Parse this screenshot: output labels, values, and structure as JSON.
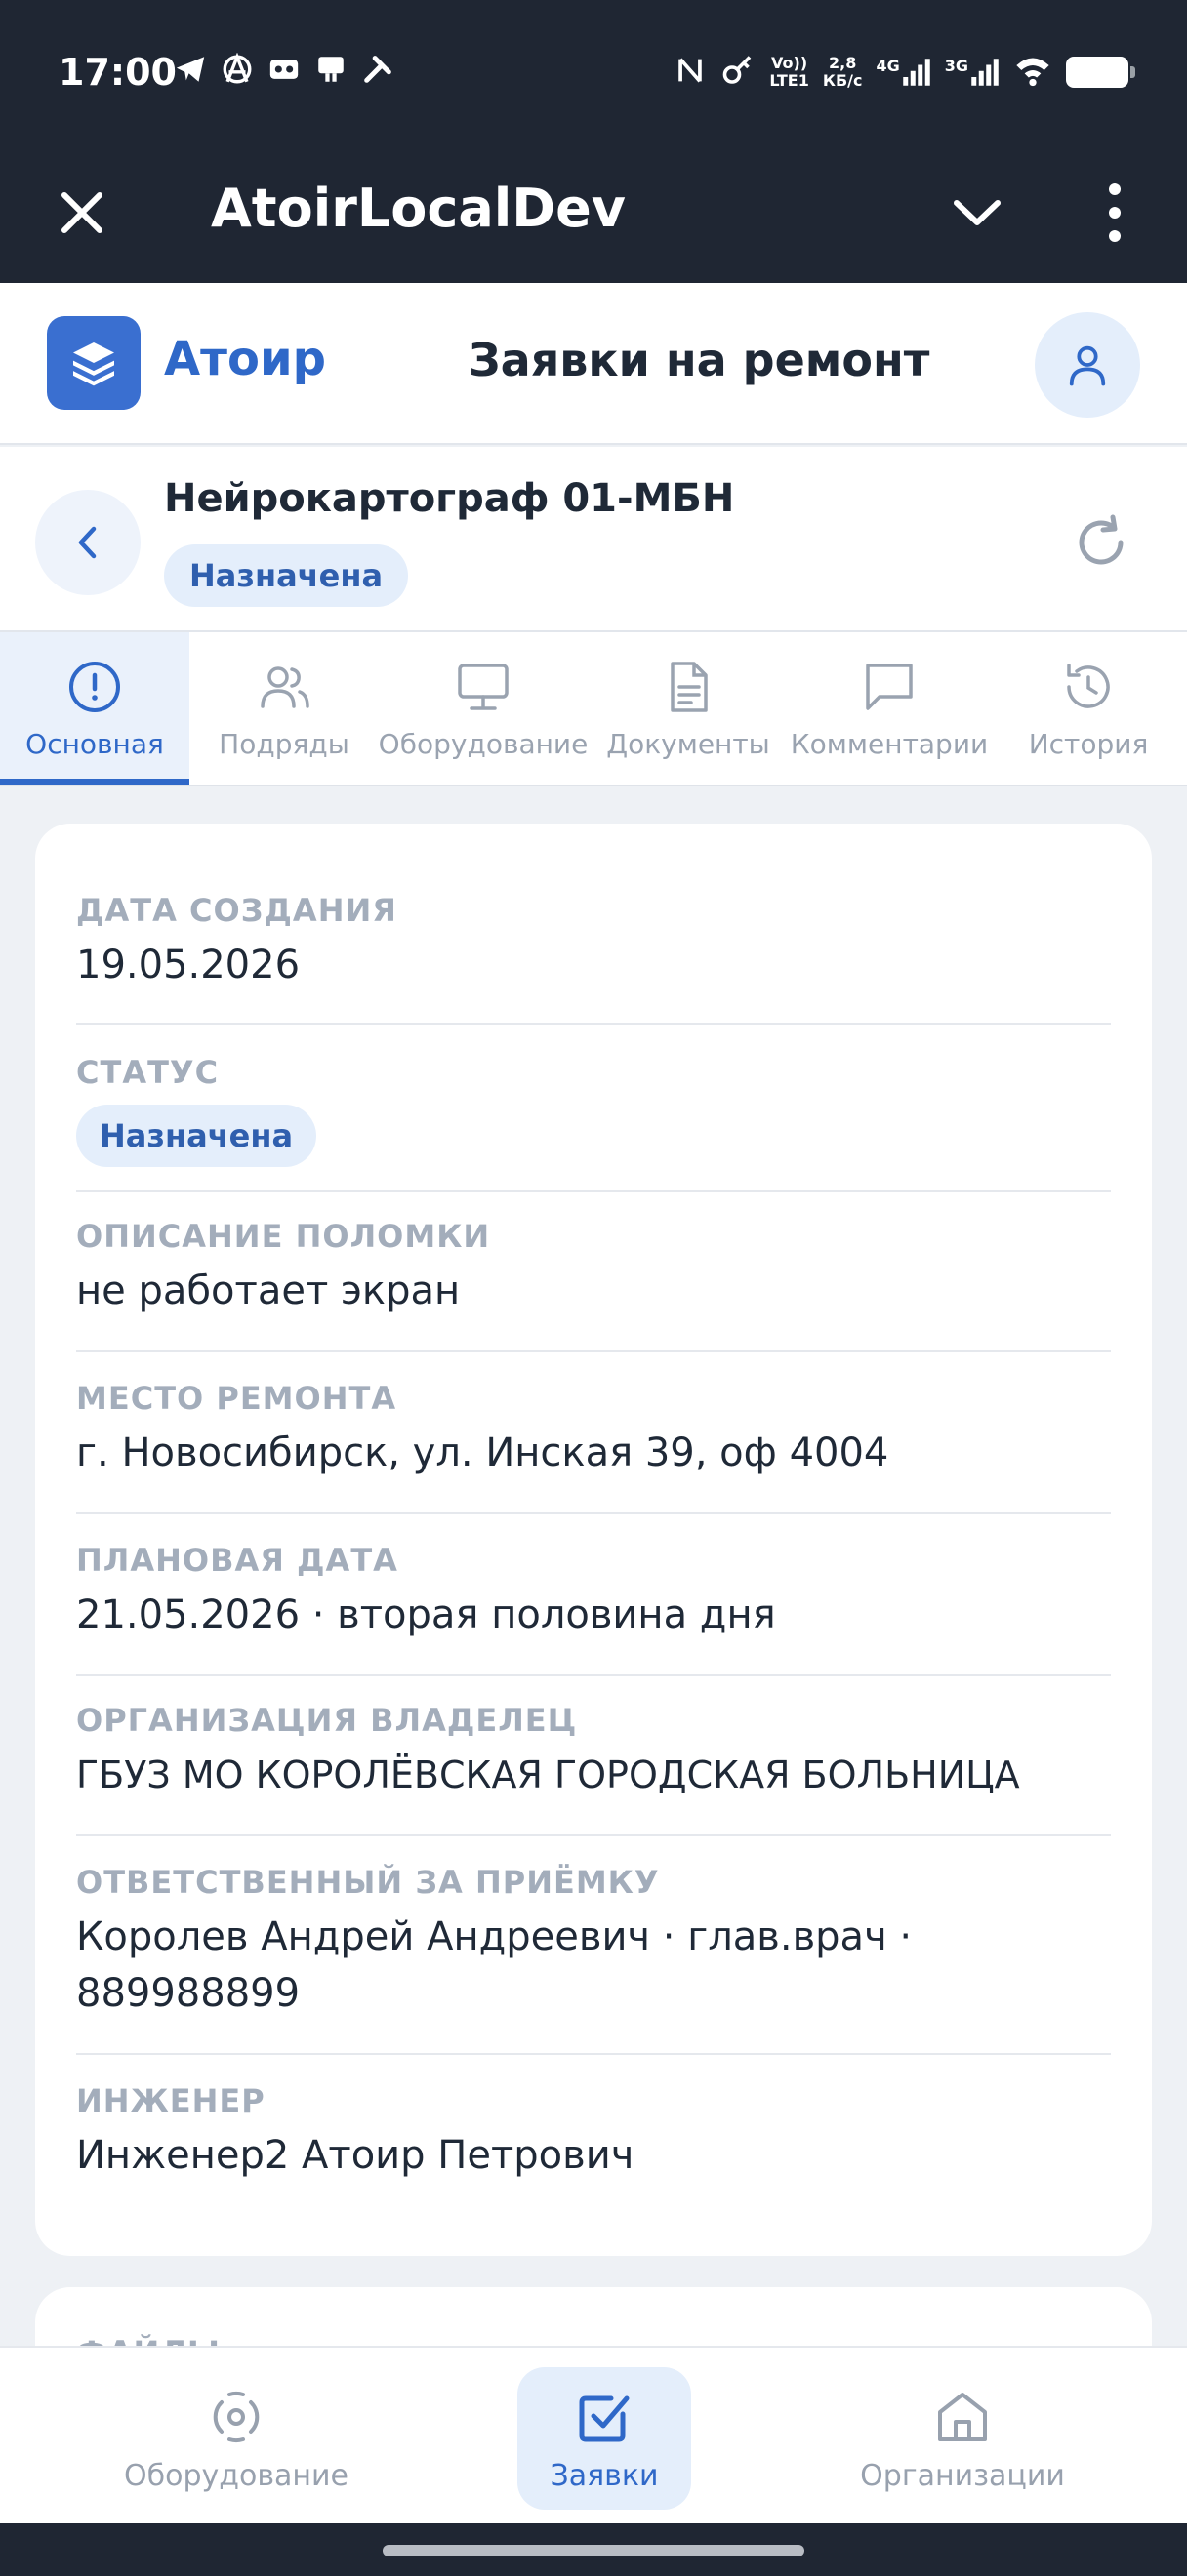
{
  "status_bar": {
    "time": "17:00",
    "network_volte": "Vo))",
    "network_lte": "LTE1",
    "speed_value": "2,8",
    "speed_unit": "КБ/с",
    "sim1": "4G",
    "sim2": "3G"
  },
  "webview": {
    "title": "AtoirLocalDev"
  },
  "header": {
    "logo_text": "Атоир",
    "page_title": "Заявки на ремонт"
  },
  "request": {
    "title": "Нейрокартограф 01-МБН",
    "status_badge": "Назначена"
  },
  "tabs": [
    {
      "label": "Основная",
      "icon": "info-icon",
      "active": true
    },
    {
      "label": "Подряды",
      "icon": "users-icon",
      "active": false
    },
    {
      "label": "Оборудование",
      "icon": "monitor-icon",
      "active": false
    },
    {
      "label": "Документы",
      "icon": "document-icon",
      "active": false
    },
    {
      "label": "Комментарии",
      "icon": "comment-icon",
      "active": false
    },
    {
      "label": "История",
      "icon": "history-icon",
      "active": false
    }
  ],
  "details": {
    "created_label": "ДАТА СОЗДАНИЯ",
    "created_value": "19.05.2026",
    "status_label": "СТАТУС",
    "status_value": "Назначена",
    "description_label": "ОПИСАНИЕ ПОЛОМКИ",
    "description_value": "не работает экран",
    "location_label": "МЕСТО РЕМОНТА",
    "location_value": "г. Новосибирск, ул. Инская 39, оф 4004",
    "planned_label": "ПЛАНОВАЯ ДАТА",
    "planned_value": "21.05.2026 · вторая половина дня",
    "owner_label": "ОРГАНИЗАЦИЯ ВЛАДЕЛЕЦ",
    "owner_value": "ГБУЗ МО КОРОЛЁВСКАЯ ГОРОДСКАЯ БОЛЬНИЦА",
    "responsible_label": "ОТВЕТСТВЕННЫЙ ЗА ПРИЁМКУ",
    "responsible_line1": "Королев Андрей Андреевич · глав.врач ·",
    "responsible_line2": "889988899",
    "engineer_label": "ИНЖЕНЕР",
    "engineer_value": "Инженер2 Атоир Петрович"
  },
  "files": {
    "label": "ФАЙЛЫ"
  },
  "bottom_nav": {
    "equipment": "Оборудование",
    "requests": "Заявки",
    "organizations": "Организации"
  },
  "colors": {
    "accent": "#2f68c8",
    "dark_bar": "#1f2633",
    "badge_bg": "#e4eefb"
  }
}
